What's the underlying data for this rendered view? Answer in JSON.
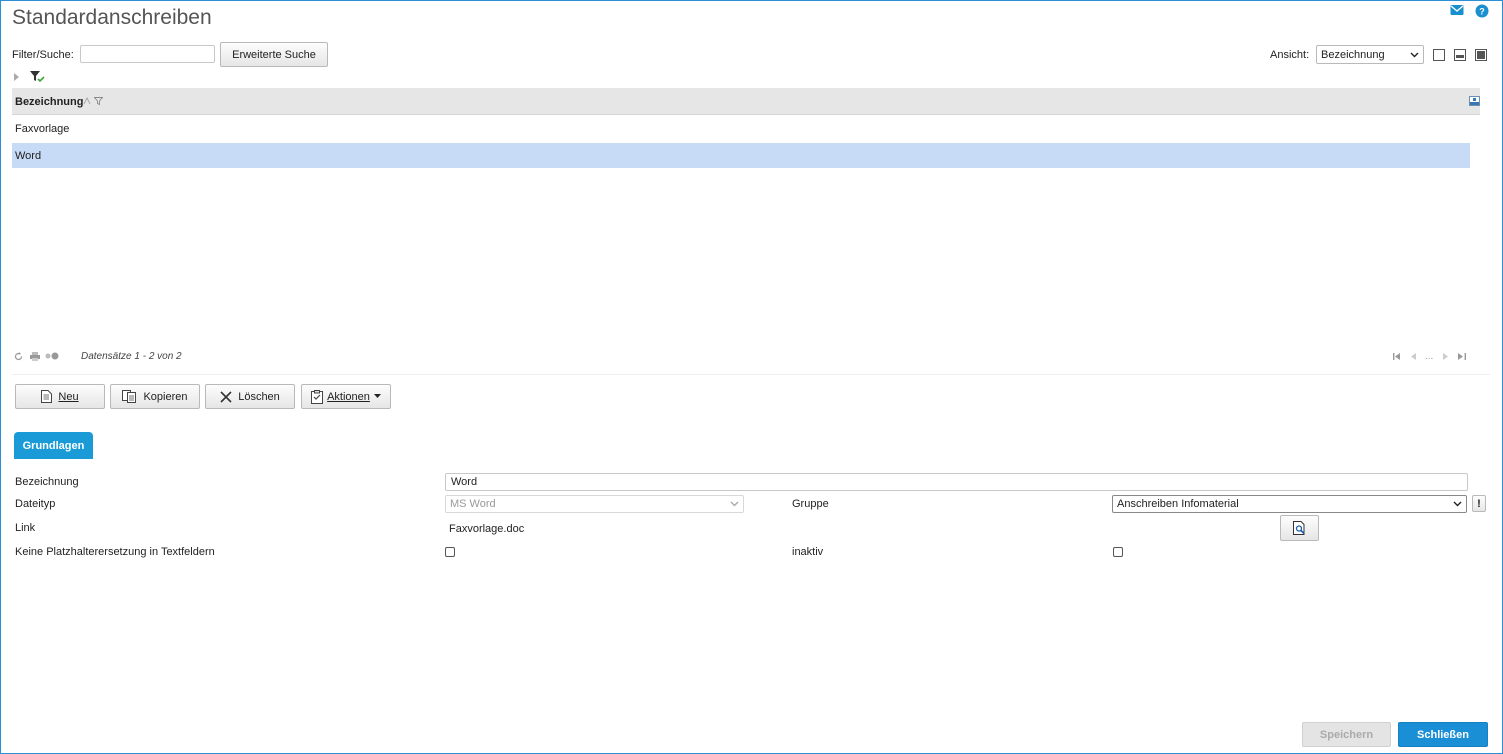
{
  "page": {
    "title": "Standardanschreiben"
  },
  "filter": {
    "label": "Filter/Suche:",
    "value": "",
    "advanced_button": "Erweiterte Suche"
  },
  "view": {
    "label": "Ansicht:",
    "selected": "Bezeichnung"
  },
  "grid": {
    "column_header": "Bezeichnung",
    "rows": [
      "Faxvorlage",
      "Word"
    ],
    "selected_row": 1,
    "records_text": "Datensätze 1 - 2 von 2",
    "pager_ellipsis": "..."
  },
  "toolbar": {
    "new": "Neu",
    "copy": "Kopieren",
    "delete": "Löschen",
    "actions": "Aktionen"
  },
  "tabs": [
    {
      "label": "Grundlagen",
      "active": true
    }
  ],
  "form": {
    "bezeichnung_label": "Bezeichnung",
    "bezeichnung_value": "Word",
    "dateityp_label": "Dateityp",
    "dateityp_value": "MS Word",
    "gruppe_label": "Gruppe",
    "gruppe_value": "Anschreiben Infomaterial",
    "link_label": "Link",
    "link_value": "Faxvorlage.doc",
    "platzhalter_label": "Keine Platzhalterersetzung in Textfeldern",
    "platzhalter_checked": false,
    "inaktiv_label": "inaktiv",
    "inaktiv_checked": false
  },
  "footer": {
    "save": "Speichern",
    "close": "Schließen"
  },
  "colors": {
    "accent": "#1a9bd8",
    "selected_row": "#c7daf6",
    "header_bg": "#e6e6e6",
    "frame": "#2b8fd6"
  },
  "icons": [
    "mail-icon",
    "help-icon",
    "expand-arrow-icon",
    "filter-check-icon",
    "sort-asc-icon",
    "column-filter-icon",
    "column-chooser-icon",
    "refresh-icon",
    "print-icon",
    "toggle-icon",
    "first-page-icon",
    "prev-page-icon",
    "next-page-icon",
    "last-page-icon",
    "new-document-icon",
    "copy-icon",
    "delete-x-icon",
    "actions-clipboard-icon",
    "chevron-down-icon",
    "warning-icon",
    "link-browse-icon"
  ]
}
